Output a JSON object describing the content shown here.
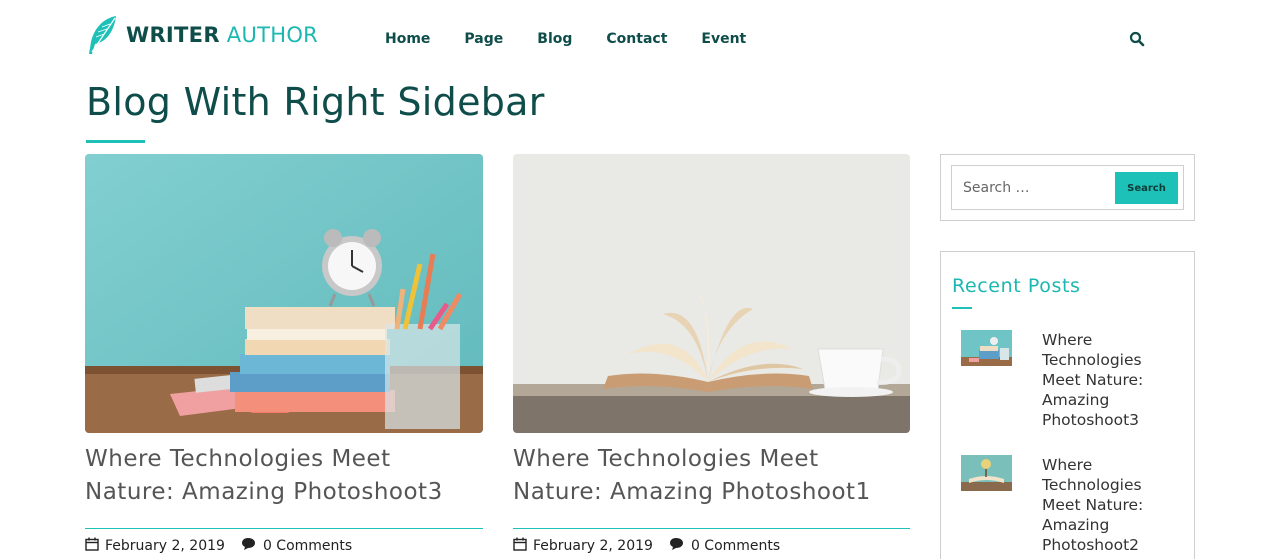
{
  "header": {
    "logo": {
      "word1": "WRITER",
      "word2": "AUTHOR",
      "icon": "feather-icon"
    },
    "nav": [
      "Home",
      "Page",
      "Blog",
      "Contact",
      "Event"
    ],
    "search_icon": "search-icon"
  },
  "page": {
    "title": "Blog With Right Sidebar"
  },
  "posts": [
    {
      "title": "Where Technologies Meet Nature: Amazing Photoshoot3",
      "date": "February 2, 2019",
      "comments": "0 Comments",
      "image": "clock-books-pencils-photo"
    },
    {
      "title": "Where Technologies Meet Nature: Amazing Photoshoot1",
      "date": "February 2, 2019",
      "comments": "0 Comments",
      "image": "open-book-coffee-cup-photo"
    }
  ],
  "sidebar": {
    "search": {
      "placeholder": "Search …",
      "button": "Search"
    },
    "recent": {
      "title": "Recent Posts",
      "items": [
        {
          "title": "Where Technologies Meet Nature: Amazing Photoshoot3"
        },
        {
          "title": "Where Technologies Meet Nature: Amazing Photoshoot2"
        }
      ]
    }
  },
  "colors": {
    "accent": "#1ec1b7",
    "dark_teal": "#0e4d4a",
    "text": "#333333"
  }
}
